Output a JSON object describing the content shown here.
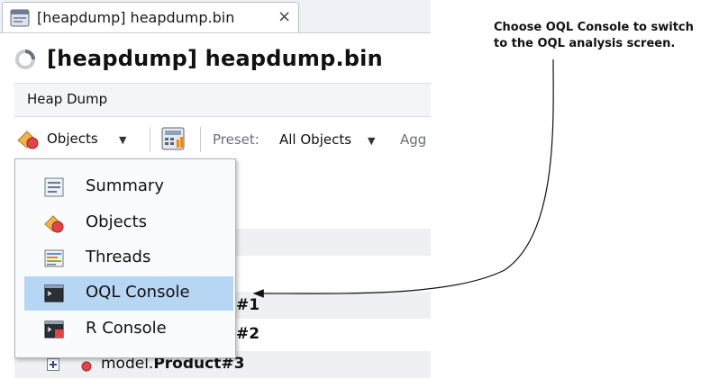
{
  "tab": {
    "label": "[heapdump] heapdump.bin",
    "close": "×"
  },
  "page_title": "[heapdump] heapdump.bin",
  "section": {
    "label": "Heap Dump"
  },
  "toolbar": {
    "objects_label": "Objects",
    "preset_label": "Preset:",
    "preset_value": "All Objects",
    "aggregation_partial": "Agg"
  },
  "menu": {
    "items": [
      {
        "label": "Summary",
        "icon": "summary-icon"
      },
      {
        "label": "Objects",
        "icon": "objects-icon"
      },
      {
        "label": "Threads",
        "icon": "threads-icon"
      },
      {
        "label": "OQL Console",
        "icon": "console-icon",
        "selected": true
      },
      {
        "label": "R Console",
        "icon": "r-console-icon"
      }
    ]
  },
  "rows": [
    {
      "suffix": "#1"
    },
    {
      "suffix": "#2"
    },
    {
      "prefix": "model.",
      "name": "Product",
      "suffix": "#3"
    }
  ],
  "annotation": {
    "text": "Choose OQL Console to switch to the OQL analysis screen."
  },
  "colors": {
    "selected": "#b6d6f3",
    "accent_orange": "#e88a1a",
    "red_dot": "#e0454a"
  }
}
